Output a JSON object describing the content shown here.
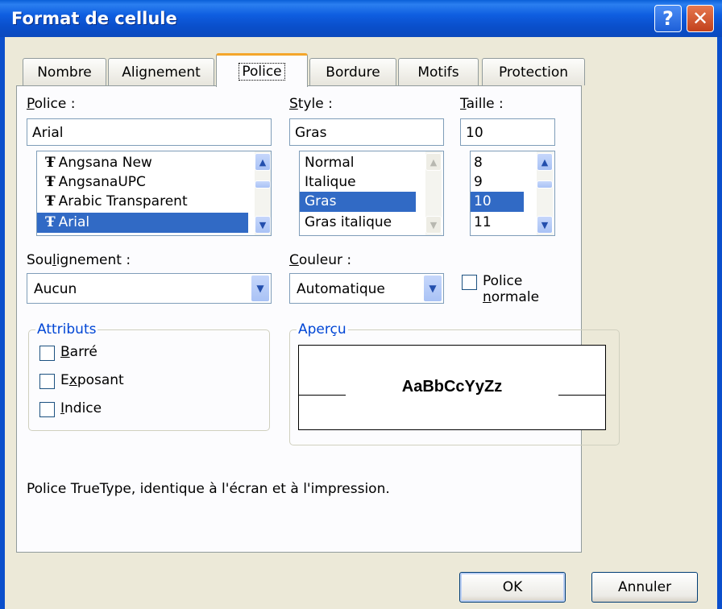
{
  "window": {
    "title": "Format de cellule",
    "help_label": "?",
    "close_label": "✕"
  },
  "tabs": [
    {
      "label": "Nombre"
    },
    {
      "label": "Alignement"
    },
    {
      "label": "Police"
    },
    {
      "label": "Bordure"
    },
    {
      "label": "Motifs"
    },
    {
      "label": "Protection"
    }
  ],
  "active_tab": "Police",
  "police": {
    "label_accel": "P",
    "label_rest": "olice :",
    "value": "Arial",
    "items": [
      {
        "label": "Angsana New",
        "icon": "truetype-icon"
      },
      {
        "label": "AngsanaUPC",
        "icon": "truetype-icon"
      },
      {
        "label": "Arabic Transparent",
        "icon": "truetype-icon"
      },
      {
        "label": "Arial",
        "icon": "truetype-icon",
        "selected": true
      }
    ]
  },
  "style": {
    "label_accel": "S",
    "label_rest": "tyle :",
    "value": "Gras",
    "items": [
      {
        "label": "Normal"
      },
      {
        "label": "Italique"
      },
      {
        "label": "Gras",
        "selected": true
      },
      {
        "label": "Gras italique"
      }
    ]
  },
  "taille": {
    "label_accel": "T",
    "label_rest": "aille :",
    "value": "10",
    "items": [
      {
        "label": "8"
      },
      {
        "label": "9"
      },
      {
        "label": "10",
        "selected": true
      },
      {
        "label": "11"
      }
    ]
  },
  "soulignement": {
    "label_pre": "Sou",
    "label_accel": "l",
    "label_rest": "ignement :",
    "value": "Aucun"
  },
  "couleur": {
    "label_accel": "C",
    "label_rest": "ouleur :",
    "value": "Automatique"
  },
  "police_normale": {
    "label_pre": "Police ",
    "label_accel": "n",
    "label_rest": "ormale",
    "checked": false
  },
  "attributs": {
    "legend": "Attributs",
    "barre": {
      "accel": "B",
      "rest": "arré",
      "checked": false
    },
    "exposant": {
      "pre": "E",
      "accel": "x",
      "rest": "posant",
      "checked": false
    },
    "indice": {
      "accel": "I",
      "rest": "ndice",
      "checked": false
    }
  },
  "apercu": {
    "legend": "Aperçu",
    "sample": "AaBbCcYyZz"
  },
  "info_text": "Police TrueType, identique à l'écran et à l'impression.",
  "buttons": {
    "ok": "OK",
    "cancel": "Annuler"
  },
  "colors": {
    "titlebar": "#0b4fcc",
    "selection": "#316ac5",
    "active_tab_accent": "#f4a62b",
    "group_legend": "#0046d5"
  }
}
